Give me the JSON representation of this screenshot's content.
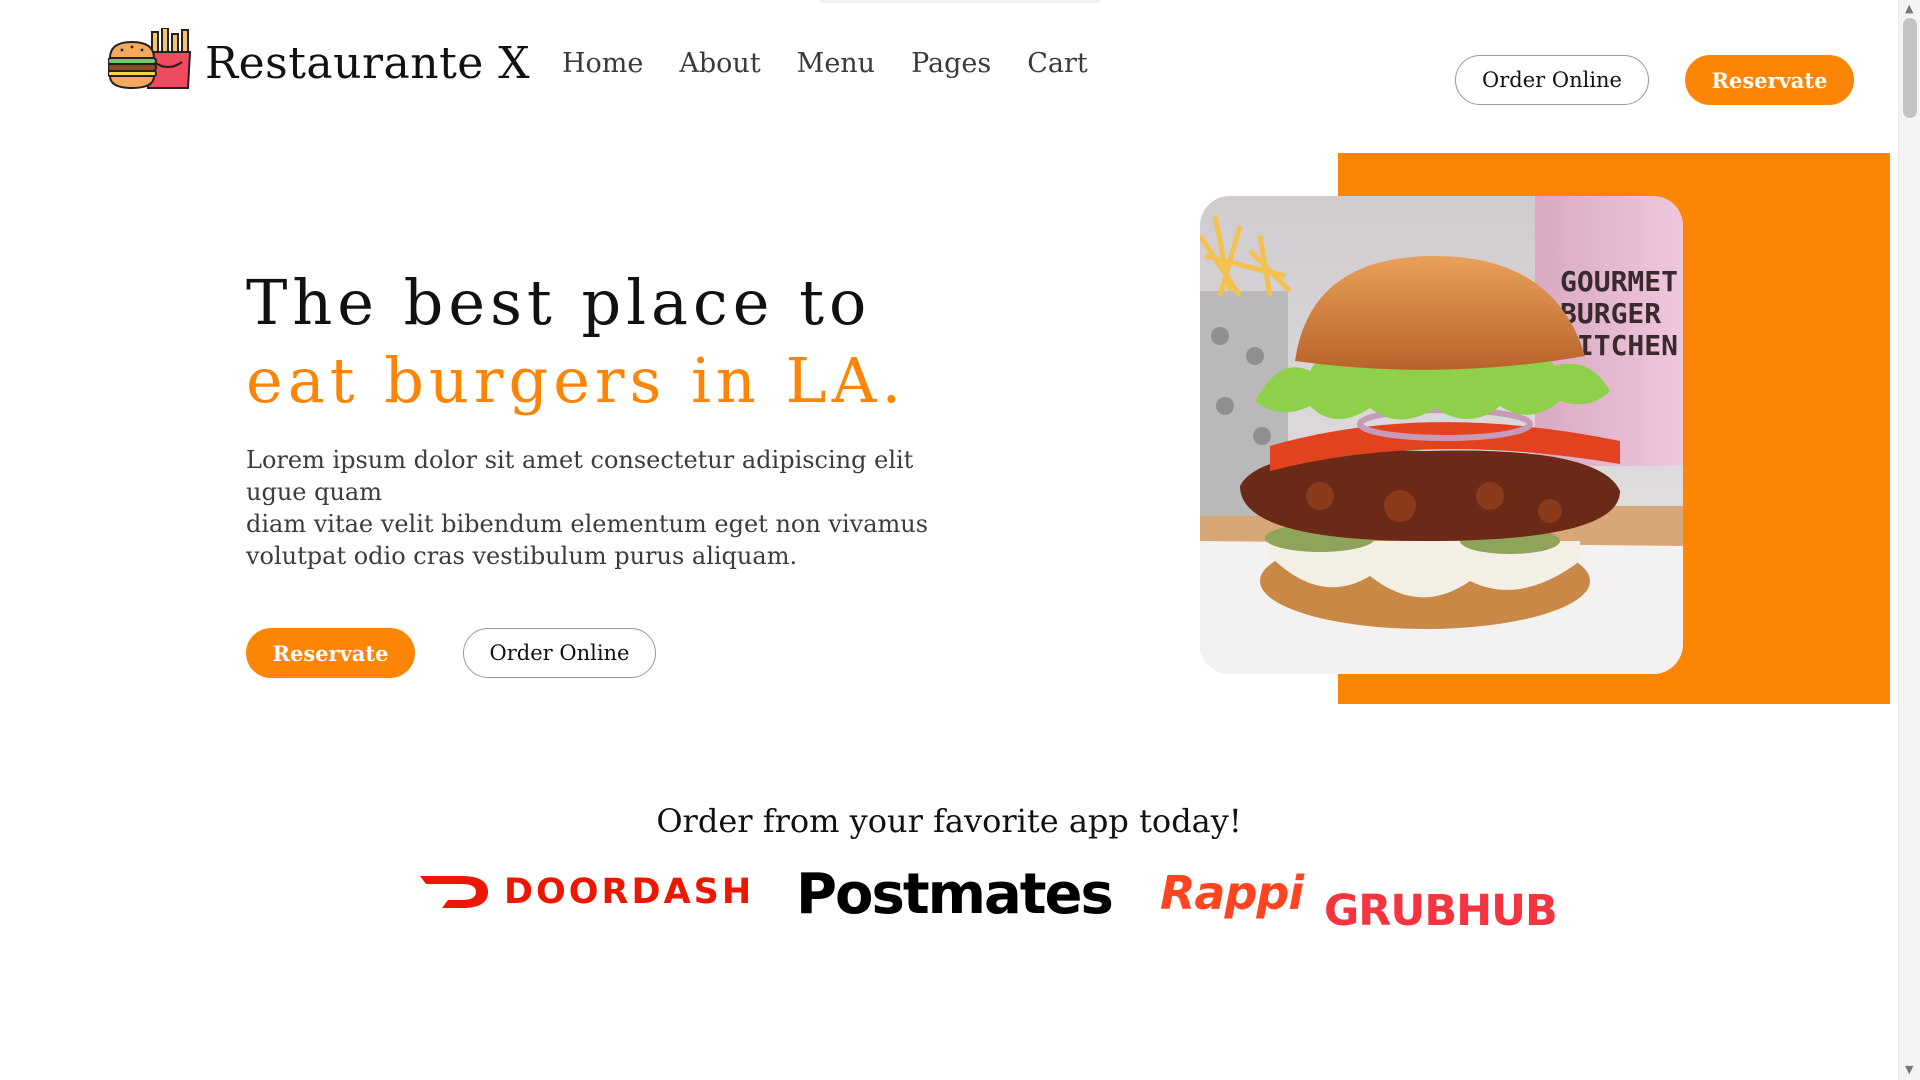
{
  "header": {
    "brand": "Restaurante X",
    "nav": [
      "Home",
      "About",
      "Menu",
      "Pages",
      "Cart"
    ],
    "order_online_label": "Order Online",
    "reservate_label": "Reservate"
  },
  "hero": {
    "title_line1": "The best place to",
    "title_line2": "eat burgers in LA.",
    "text_lines": [
      "Lorem ipsum dolor sit amet consectetur adipiscing elit ugue quam",
      "diam vitae velit bibendum elementum eget non vivamus",
      "volutpat odio cras vestibulum purus aliquam."
    ],
    "reservate_label": "Reservate",
    "order_online_label": "Order Online",
    "photo_cup_text": [
      "GOURMET",
      "BURGER",
      "KITCHEN"
    ]
  },
  "order_section": {
    "title": "Order from your favorite app today!",
    "partners": [
      "DOORDASH",
      "Postmates",
      "Rappi",
      "GRUBHUB"
    ]
  },
  "colors": {
    "accent": "#fd8506",
    "doordash": "#eb1700",
    "rappi": "#ff441f",
    "grubhub": "#f63440",
    "text_dark": "#111111"
  },
  "icons": {
    "logo": "burger-and-fries-icon",
    "doordash": "doordash-logo-icon",
    "scroll_up": "scroll-up-arrow-icon",
    "scroll_down": "scroll-down-arrow-icon"
  }
}
